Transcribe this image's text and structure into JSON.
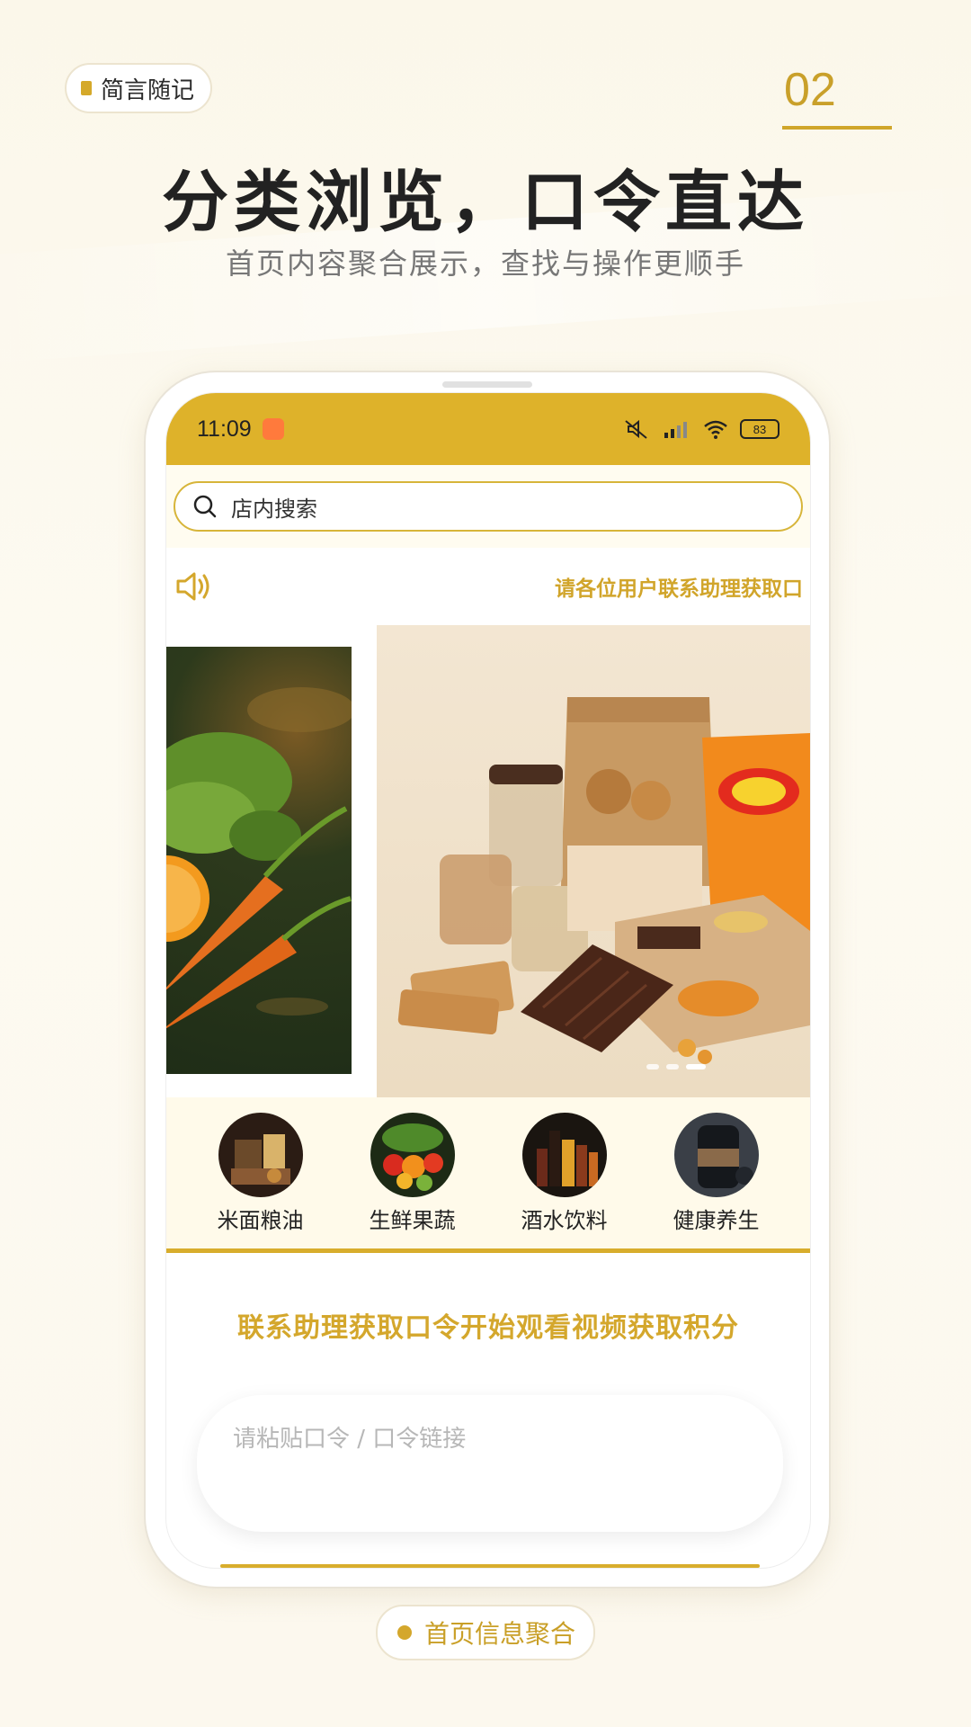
{
  "header": {
    "brand": "简言随记",
    "page_number": "02",
    "title": "分类浏览，口令直达",
    "subtitle": "首页内容聚合展示，查找与操作更顺手"
  },
  "status_bar": {
    "time": "11:09",
    "battery": "83"
  },
  "search": {
    "placeholder": "店内搜索"
  },
  "notice": {
    "text": "请各位用户联系助理获取口"
  },
  "categories": [
    {
      "label": "米面粮油"
    },
    {
      "label": "生鲜果蔬"
    },
    {
      "label": "酒水饮料"
    },
    {
      "label": "健康养生"
    }
  ],
  "cta": {
    "text": "联系助理获取口令开始观看视频获取积分"
  },
  "paste_input": {
    "placeholder": "请粘贴口令 / 口令链接"
  },
  "footer": {
    "tag": "首页信息聚合"
  },
  "colors": {
    "accent": "#deb22a",
    "accent_text": "#d4a72c"
  }
}
